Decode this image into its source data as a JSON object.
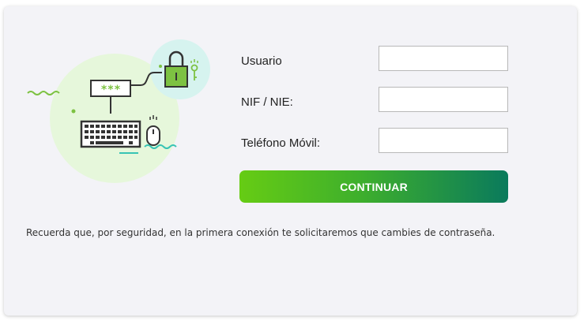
{
  "form": {
    "fields": [
      {
        "label": "Usuario",
        "value": "",
        "placeholder": ""
      },
      {
        "label": "NIF / NIE:",
        "value": "",
        "placeholder": ""
      },
      {
        "label": "Teléfono Móvil:",
        "value": "",
        "placeholder": ""
      }
    ],
    "submit_label": "CONTINUAR"
  },
  "illustration": {
    "password_mask": "***",
    "icons": [
      "padlock-icon",
      "key-icon",
      "keyboard-icon",
      "mouse-icon",
      "password-field-icon"
    ]
  },
  "footer_note": "Recuerda que, por seguridad, en la primera conexión te solicitaremos que cambies de contraseña.",
  "colors": {
    "card_background": "#f3f3f7",
    "button_gradient_start": "#66cc14",
    "button_gradient_end": "#0a7a5c",
    "illustration_green": "#7dc242",
    "illustration_teal": "#38c4b4"
  }
}
